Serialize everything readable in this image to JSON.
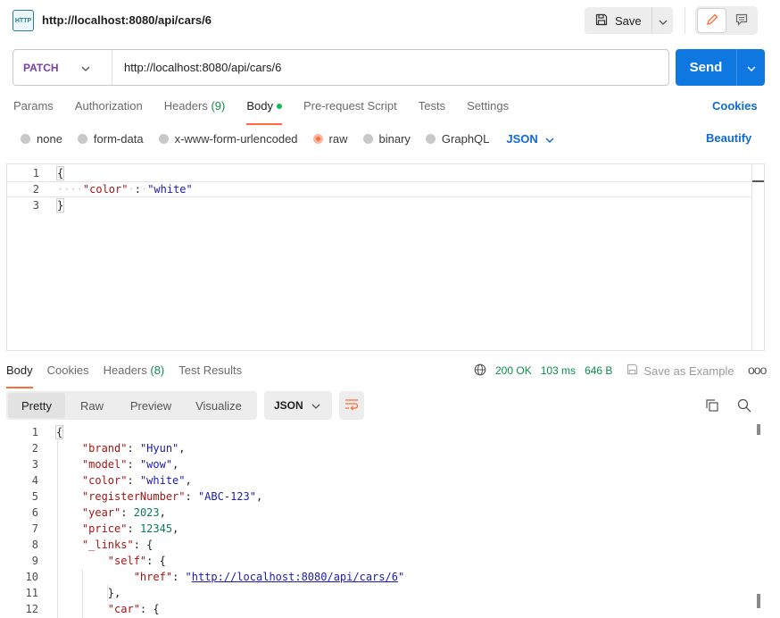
{
  "tab": {
    "icon_text": "HTTP",
    "title": "http://localhost:8080/api/cars/6"
  },
  "toolbar": {
    "save_label": "Save"
  },
  "request": {
    "method": "PATCH",
    "url": "http://localhost:8080/api/cars/6",
    "send_label": "Send",
    "tabs": [
      {
        "label": "Params"
      },
      {
        "label": "Authorization"
      },
      {
        "label": "Headers",
        "count": "(9)"
      },
      {
        "label": "Body"
      },
      {
        "label": "Pre-request Script"
      },
      {
        "label": "Tests"
      },
      {
        "label": "Settings"
      }
    ],
    "cookies_label": "Cookies",
    "body_types": [
      "none",
      "form-data",
      "x-www-form-urlencoded",
      "raw",
      "binary",
      "GraphQL"
    ],
    "selected_body_type": "raw",
    "language": "JSON",
    "beautify_label": "Beautify",
    "body_lines": [
      {
        "n": "1",
        "text": "{"
      },
      {
        "n": "2",
        "key": "\"color\"",
        "value": "\"white\""
      },
      {
        "n": "3",
        "text": "}"
      }
    ]
  },
  "response": {
    "tabs": [
      {
        "label": "Body"
      },
      {
        "label": "Cookies"
      },
      {
        "label": "Headers",
        "count": "(8)"
      },
      {
        "label": "Test Results"
      }
    ],
    "status": "200 OK",
    "time": "103 ms",
    "size": "646 B",
    "save_example_label": "Save as Example",
    "more_label": "ooo",
    "views": [
      "Pretty",
      "Raw",
      "Preview",
      "Visualize"
    ],
    "active_view": "Pretty",
    "language": "JSON",
    "lines": [
      {
        "n": "1",
        "text": "{"
      },
      {
        "n": "2",
        "key": "\"brand\"",
        "value": "\"Hyun\"",
        "trail": ","
      },
      {
        "n": "3",
        "key": "\"model\"",
        "value": "\"wow\"",
        "trail": ","
      },
      {
        "n": "4",
        "key": "\"color\"",
        "value": "\"white\"",
        "trail": ","
      },
      {
        "n": "5",
        "key": "\"registerNumber\"",
        "value": "\"ABC-123\"",
        "trail": ","
      },
      {
        "n": "6",
        "key": "\"year\"",
        "value": "2023",
        "trail": ","
      },
      {
        "n": "7",
        "key": "\"price\"",
        "value": "12345",
        "trail": ","
      },
      {
        "n": "8",
        "key": "\"_links\"",
        "value": "{",
        "trail": ""
      },
      {
        "n": "9",
        "key": "\"self\"",
        "value": "{",
        "trail": ""
      },
      {
        "n": "10",
        "key": "\"href\"",
        "value": "http://localhost:8080/api/cars/6",
        "trail": ""
      },
      {
        "n": "11",
        "text": "},"
      },
      {
        "n": "12",
        "key": "\"car\"",
        "value": "{",
        "trail": ""
      }
    ]
  },
  "colors": {
    "accent": "#ff6c37",
    "primary": "#0f78e0",
    "success": "#0a8f4a"
  }
}
